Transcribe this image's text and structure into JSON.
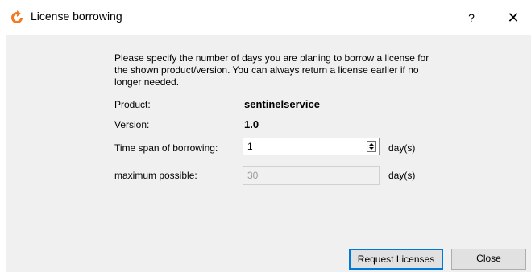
{
  "window": {
    "title": "License borrowing",
    "help_label": "?",
    "close_label": "✕"
  },
  "dialog": {
    "intro": "Please specify the number of days you are planing to borrow a license for the shown product/version. You can always return a license earlier if no longer needed.",
    "product_label": "Product:",
    "product_value": "sentinelservice",
    "version_label": "Version:",
    "version_value": "1.0",
    "timespan_label": "Time span of borrowing:",
    "timespan_value": "1",
    "timespan_unit": "day(s)",
    "max_label": "maximum possible:",
    "max_value": "30",
    "max_unit": "day(s)"
  },
  "buttons": {
    "request_label": "Request Licenses",
    "close_label": "Close"
  },
  "colors": {
    "accent": "#0078d7",
    "icon": "#f47a20"
  }
}
